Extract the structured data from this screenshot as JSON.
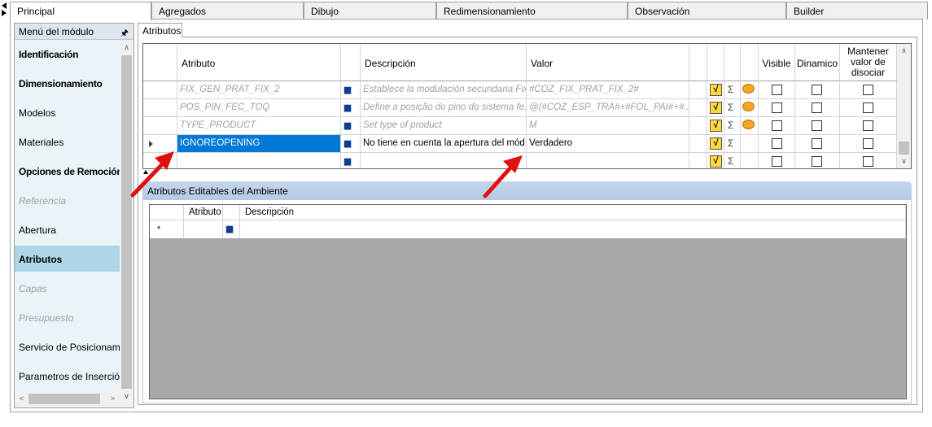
{
  "tabs": [
    {
      "label": "Principal",
      "active": true
    },
    {
      "label": "Agregados"
    },
    {
      "label": "Dibujo"
    },
    {
      "label": "Redimensionamiento"
    },
    {
      "label": "Observación"
    },
    {
      "label": "Builder"
    }
  ],
  "sidebar": {
    "header": "Menú del módulo",
    "items": [
      {
        "label": "Identificación",
        "style": "bold"
      },
      {
        "label": "Dimensionamiento",
        "style": "bold"
      },
      {
        "label": "Modelos",
        "style": "normal"
      },
      {
        "label": "Materiales",
        "style": "normal"
      },
      {
        "label": "Opciones de Remoción",
        "style": "bold"
      },
      {
        "label": "Referencia",
        "style": "disabled"
      },
      {
        "label": "Abertura",
        "style": "normal"
      },
      {
        "label": "Atributos",
        "style": "selected"
      },
      {
        "label": "Capas",
        "style": "disabled"
      },
      {
        "label": "Presupuesto",
        "style": "disabled"
      },
      {
        "label": "Servicio de Posicionamiento",
        "style": "normal"
      },
      {
        "label": "Parametros de Inserción",
        "style": "normal"
      }
    ]
  },
  "attributes_tab": "Atributos",
  "grid": {
    "headers": {
      "atributo": "Atributo",
      "descripcion": "Descripción",
      "valor": "Valor",
      "visible": "Visible",
      "dinamico": "Dinamico",
      "mantener": "Mantener valor de disociar"
    },
    "rows": [
      {
        "atributo": "FIX_GEN_PRAT_FIX_2",
        "descripcion": "Establece la modulación secundaria Fixer",
        "valor": "#COZ_FIX_PRAT_FIX_2#",
        "style": "inherited",
        "has_comment": true
      },
      {
        "atributo": "POS_PIN_FEC_TOQ",
        "descripcion": "Define a posição do pino do sistema fe...",
        "valor": "@(#COZ_ESP_TRA#+#FOL_PAI#+#...",
        "style": "inherited",
        "has_comment": true
      },
      {
        "atributo": "TYPE_PRODUCT",
        "descripcion": "Set type of product",
        "valor": "M",
        "style": "inherited",
        "has_comment": true
      },
      {
        "atributo": "IGNOREOPENING",
        "descripcion": "No tiene en cuenta la apertura del mód...",
        "valor": "Verdadero",
        "style": "current",
        "has_comment": false
      },
      {
        "atributo": "",
        "descripcion": "",
        "valor": "",
        "style": "new",
        "has_comment": false
      }
    ]
  },
  "editable": {
    "title": "Atributos Editables del Ambiente",
    "headers": {
      "atributo": "Atributo",
      "descripcion": "Descripción"
    },
    "new_row_marker": "*"
  },
  "icons": {
    "find": "binoculars-icon",
    "formula": "sqrt-formula-icon",
    "sum": "sigma-icon",
    "comment": "speech-bubble-icon"
  },
  "colors": {
    "selected_cell": "#0078d7",
    "sidebar_selected": "#aed6e6",
    "panel_header": "#b8cce8",
    "annotation_arrow": "#e01010"
  }
}
